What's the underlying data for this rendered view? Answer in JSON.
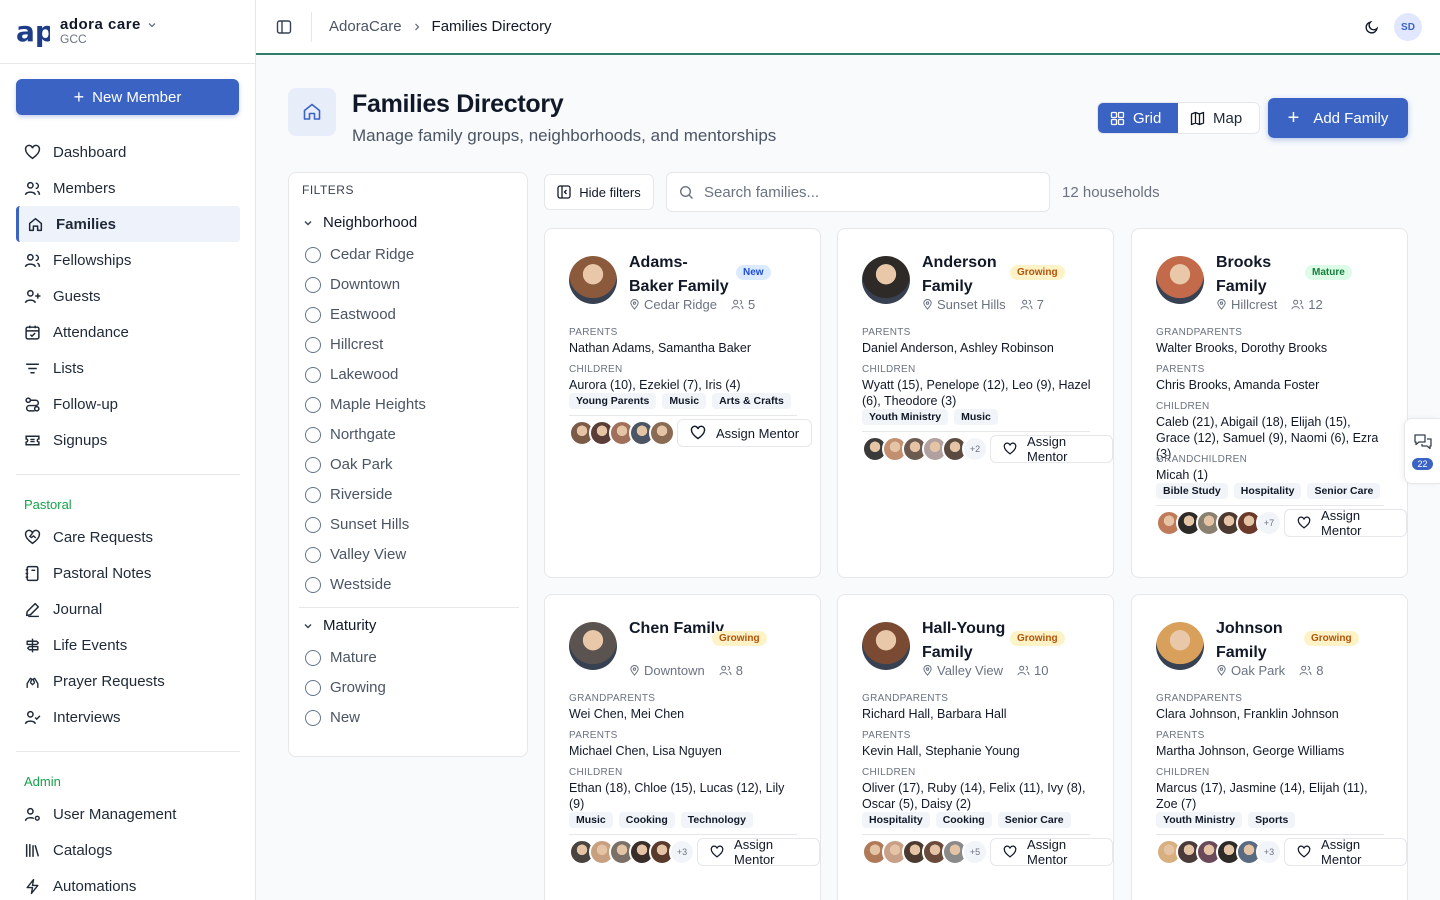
{
  "brand": {
    "name": "adora care",
    "org": "GCC"
  },
  "sidebar": {
    "new_member_label": "New Member",
    "main": [
      {
        "label": "Dashboard",
        "icon": "heart-icon"
      },
      {
        "label": "Members",
        "icon": "users-icon"
      },
      {
        "label": "Families",
        "icon": "home-icon",
        "active": true
      },
      {
        "label": "Fellowships",
        "icon": "users-icon"
      },
      {
        "label": "Guests",
        "icon": "user-plus-icon"
      },
      {
        "label": "Attendance",
        "icon": "calendar-icon"
      },
      {
        "label": "Lists",
        "icon": "list-icon"
      },
      {
        "label": "Follow-up",
        "icon": "route-icon"
      },
      {
        "label": "Signups",
        "icon": "ticket-icon"
      }
    ],
    "pastoral_title": "Pastoral",
    "pastoral": [
      {
        "label": "Care Requests",
        "icon": "heart-handshake-icon"
      },
      {
        "label": "Pastoral Notes",
        "icon": "notebook-icon"
      },
      {
        "label": "Journal",
        "icon": "pen-icon"
      },
      {
        "label": "Life Events",
        "icon": "signpost-icon"
      },
      {
        "label": "Prayer Requests",
        "icon": "hands-icon"
      },
      {
        "label": "Interviews",
        "icon": "user-check-icon"
      }
    ],
    "admin_title": "Admin",
    "admin": [
      {
        "label": "User Management",
        "icon": "user-cog-icon"
      },
      {
        "label": "Catalogs",
        "icon": "library-icon"
      },
      {
        "label": "Automations",
        "icon": "zap-icon"
      }
    ]
  },
  "topbar": {
    "crumb_root": "AdoraCare",
    "crumb_current": "Families Directory",
    "avatar_initials": "SD"
  },
  "header": {
    "title": "Families Directory",
    "subtitle": "Manage family groups, neighborhoods, and mentorships",
    "grid_label": "Grid",
    "map_label": "Map",
    "add_label": "Add Family"
  },
  "filters": {
    "title": "FILTERS",
    "neighborhood_title": "Neighborhood",
    "neighborhoods": [
      "Cedar Ridge",
      "Downtown",
      "Eastwood",
      "Hillcrest",
      "Lakewood",
      "Maple Heights",
      "Northgate",
      "Oak Park",
      "Riverside",
      "Sunset Hills",
      "Valley View",
      "Westside"
    ],
    "maturity_title": "Maturity",
    "maturity": [
      "Mature",
      "Growing",
      "New"
    ]
  },
  "toolbar": {
    "hide_filters_label": "Hide filters",
    "search_placeholder": "Search families...",
    "count": "12 households"
  },
  "assign_mentor_label": "Assign Mentor",
  "chat_count": "22",
  "families": [
    {
      "name": "Adams-Baker Family",
      "badge": "New",
      "location": "Cedar Ridge",
      "members": "5",
      "sections": [
        {
          "label": "PARENTS",
          "value": "Nathan Adams, Samantha Baker"
        },
        {
          "label": "CHILDREN",
          "value": "Aurora (10), Ezekiel (7), Iris (4)"
        }
      ],
      "tags": [
        "Young Parents",
        "Music",
        "Arts & Crafts"
      ],
      "more": "",
      "photo_color": "#8b5a3c"
    },
    {
      "name": "Anderson Family",
      "badge": "Growing",
      "location": "Sunset Hills",
      "members": "7",
      "sections": [
        {
          "label": "PARENTS",
          "value": "Daniel Anderson, Ashley Robinson"
        },
        {
          "label": "CHILDREN",
          "value": "Wyatt (15), Penelope (12), Leo (9), Hazel (6), Theodore (3)"
        }
      ],
      "tags": [
        "Youth Ministry",
        "Music"
      ],
      "more": "+2",
      "photo_color": "#2d2a28"
    },
    {
      "name": "Brooks Family",
      "badge": "Mature",
      "location": "Hillcrest",
      "members": "12",
      "sections": [
        {
          "label": "GRANDPARENTS",
          "value": "Walter Brooks, Dorothy Brooks"
        },
        {
          "label": "PARENTS",
          "value": "Chris Brooks, Amanda Foster"
        },
        {
          "label": "CHILDREN",
          "value": "Caleb (21), Abigail (18), Elijah (15), Grace (12), Samuel (9), Naomi (6), Ezra (3)"
        },
        {
          "label": "GRANDCHILDREN",
          "value": "Micah (1)"
        }
      ],
      "tags": [
        "Bible Study",
        "Hospitality",
        "Senior Care"
      ],
      "more": "+7",
      "photo_color": "#c26a4a"
    },
    {
      "name": "Chen Family",
      "badge": "Growing",
      "location": "Downtown",
      "members": "8",
      "sections": [
        {
          "label": "GRANDPARENTS",
          "value": "Wei Chen, Mei Chen"
        },
        {
          "label": "PARENTS",
          "value": "Michael Chen, Lisa Nguyen"
        },
        {
          "label": "CHILDREN",
          "value": "Ethan (18), Chloe (15), Lucas (12), Lily (9)"
        }
      ],
      "tags": [
        "Music",
        "Cooking",
        "Technology"
      ],
      "more": "+3",
      "photo_color": "#5b5350"
    },
    {
      "name": "Hall-Young Family",
      "badge": "Growing",
      "location": "Valley View",
      "members": "10",
      "sections": [
        {
          "label": "GRANDPARENTS",
          "value": "Richard Hall, Barbara Hall"
        },
        {
          "label": "PARENTS",
          "value": "Kevin Hall, Stephanie Young"
        },
        {
          "label": "CHILDREN",
          "value": "Oliver (17), Ruby (14), Felix (11), Ivy (8), Oscar (5), Daisy (2)"
        }
      ],
      "tags": [
        "Hospitality",
        "Cooking",
        "Senior Care"
      ],
      "more": "+5",
      "photo_color": "#7a4b32"
    },
    {
      "name": "Johnson Family",
      "badge": "Growing",
      "location": "Oak Park",
      "members": "8",
      "sections": [
        {
          "label": "GRANDPARENTS",
          "value": "Clara Johnson, Franklin Johnson"
        },
        {
          "label": "PARENTS",
          "value": "Martha Johnson, George Williams"
        },
        {
          "label": "CHILDREN",
          "value": "Marcus (17), Jasmine (14), Elijah (11), Zoe (7)"
        }
      ],
      "tags": [
        "Youth Ministry",
        "Sports"
      ],
      "more": "+3",
      "photo_color": "#d9a05b"
    }
  ]
}
